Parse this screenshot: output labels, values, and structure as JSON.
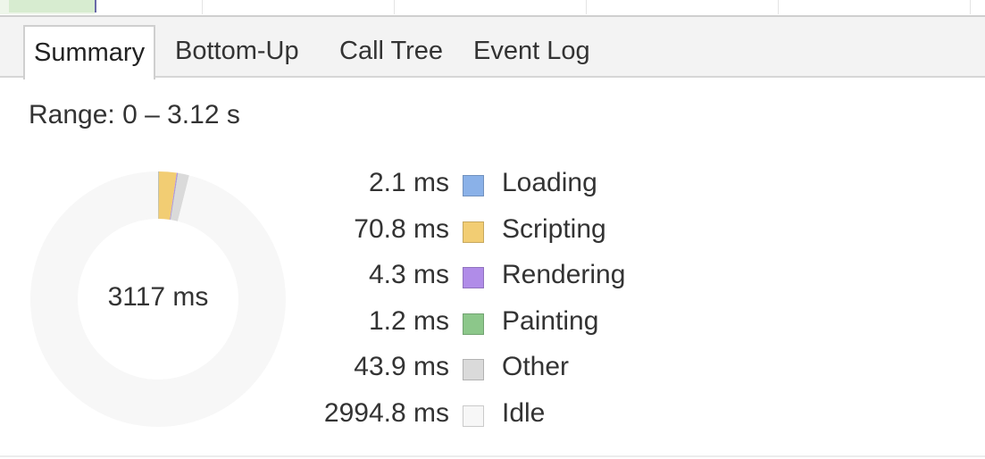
{
  "tabs": [
    {
      "label": "Summary",
      "active": true
    },
    {
      "label": "Bottom-Up",
      "active": false
    },
    {
      "label": "Call Tree",
      "active": false
    },
    {
      "label": "Event Log",
      "active": false
    }
  ],
  "range": "Range: 0 – 3.12 s",
  "total": "3117 ms",
  "categories": [
    {
      "value": "2.1 ms",
      "label": "Loading",
      "color": "#8ab1e8",
      "ms": 2.1
    },
    {
      "value": "70.8 ms",
      "label": "Scripting",
      "color": "#f2cd73",
      "ms": 70.8
    },
    {
      "value": "4.3 ms",
      "label": "Rendering",
      "color": "#b08ce8",
      "ms": 4.3
    },
    {
      "value": "1.2 ms",
      "label": "Painting",
      "color": "#8cc78a",
      "ms": 1.2
    },
    {
      "value": "43.9 ms",
      "label": "Other",
      "color": "#dadada",
      "ms": 43.9
    },
    {
      "value": "2994.8 ms",
      "label": "Idle",
      "color": "#f7f7f7",
      "ms": 2994.8
    }
  ]
}
